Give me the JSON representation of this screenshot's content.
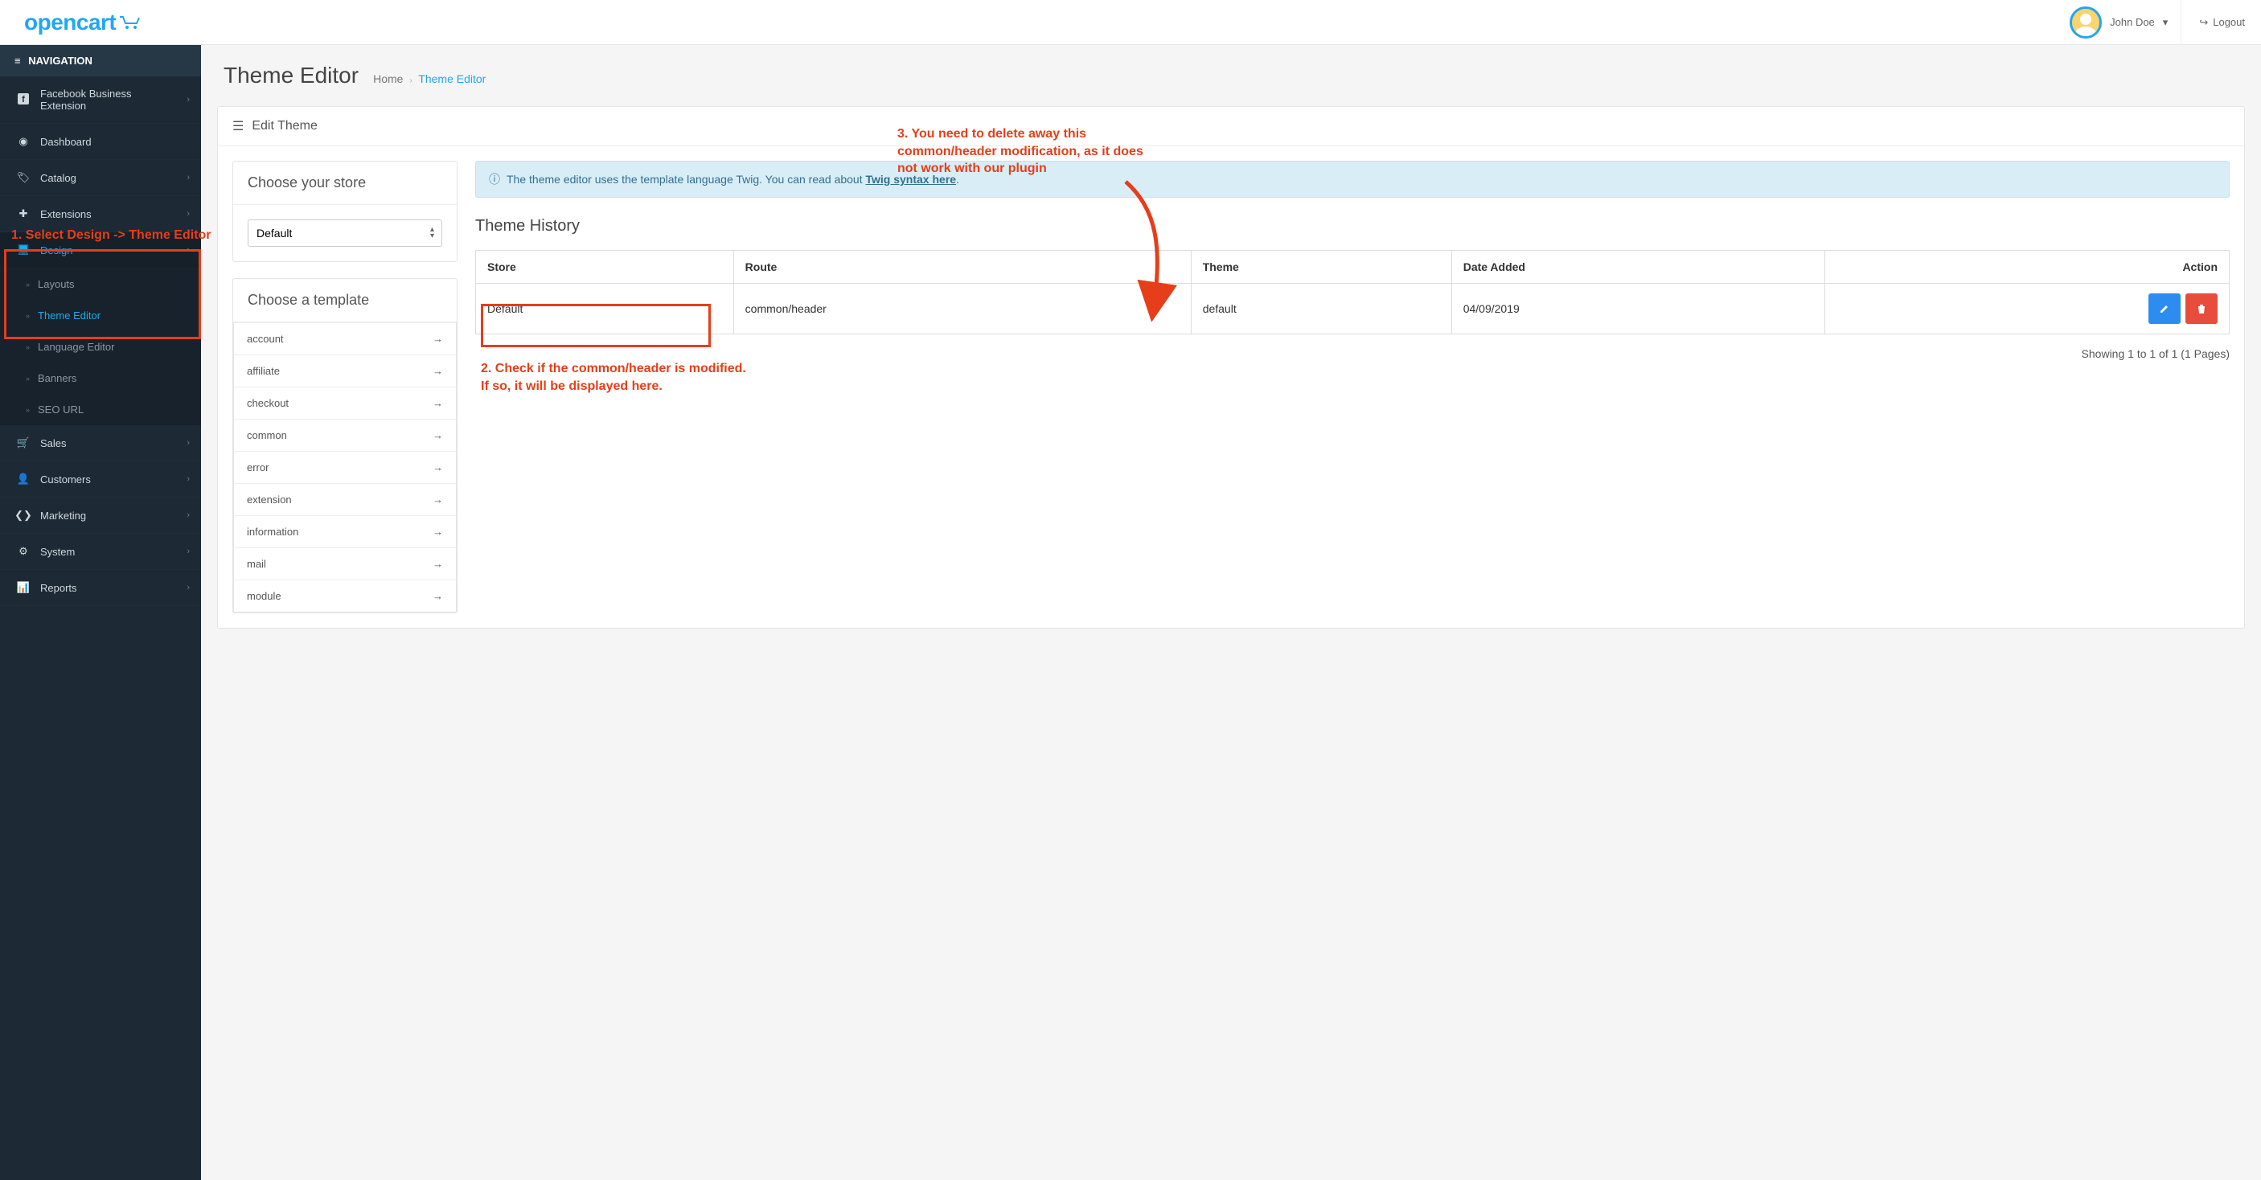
{
  "brand": "opencart",
  "header": {
    "user_name": "John Doe",
    "logout": "Logout"
  },
  "sidebar": {
    "title": "NAVIGATION",
    "items": [
      {
        "label": "Facebook Business Extension",
        "icon": "facebook"
      },
      {
        "label": "Dashboard",
        "icon": "dashboard"
      },
      {
        "label": "Catalog",
        "icon": "tags"
      },
      {
        "label": "Extensions",
        "icon": "puzzle"
      },
      {
        "label": "Design",
        "icon": "desktop",
        "active": true,
        "children": [
          {
            "label": "Layouts"
          },
          {
            "label": "Theme Editor",
            "active": true
          },
          {
            "label": "Language Editor"
          },
          {
            "label": "Banners"
          },
          {
            "label": "SEO URL"
          }
        ]
      },
      {
        "label": "Sales",
        "icon": "cart"
      },
      {
        "label": "Customers",
        "icon": "user"
      },
      {
        "label": "Marketing",
        "icon": "share"
      },
      {
        "label": "System",
        "icon": "gear"
      },
      {
        "label": "Reports",
        "icon": "chart"
      }
    ]
  },
  "page": {
    "title": "Theme Editor",
    "breadcrumb": {
      "home": "Home",
      "current": "Theme Editor"
    },
    "panel_title": "Edit Theme",
    "choose_store_title": "Choose your store",
    "store_selected": "Default",
    "choose_template_title": "Choose a template",
    "templates": [
      "account",
      "affiliate",
      "checkout",
      "common",
      "error",
      "extension",
      "information",
      "mail",
      "module"
    ],
    "alert": {
      "prefix": "The theme editor uses the template language Twig. You can read about ",
      "link": "Twig syntax here",
      "suffix": "."
    },
    "history_title": "Theme History",
    "table": {
      "headers": {
        "store": "Store",
        "route": "Route",
        "theme": "Theme",
        "date": "Date Added",
        "action": "Action"
      },
      "rows": [
        {
          "store": "Default",
          "route": "common/header",
          "theme": "default",
          "date": "04/09/2019"
        }
      ]
    },
    "pagination": "Showing 1 to 1 of 1 (1 Pages)"
  },
  "annotations": {
    "a1": "1. Select Design -> Theme Editor",
    "a2": "2. Check if the common/header is modified.\nIf so, it will be displayed here.",
    "a3": "3. You need to delete away this common/header modification, as it does not work with our plugin"
  }
}
